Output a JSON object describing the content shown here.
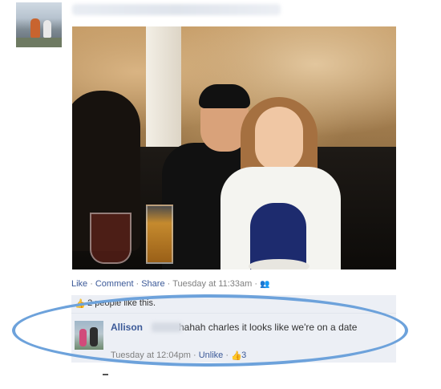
{
  "post": {
    "photo_actions": {
      "like": "Like",
      "comment": "Comment",
      "share": "Share",
      "timestamp": "Tuesday at 11:33am",
      "sep": "·"
    },
    "likes_summary": "2 people like this.",
    "comment": {
      "author": "Allison",
      "text": "hahah charles it looks like we're on a date",
      "timestamp": "Tuesday at 12:04pm",
      "unlike": "Unlike",
      "like_count": "3"
    }
  },
  "icons": {
    "thumbs_up": "thumbs-up-icon",
    "privacy": "friends-icon"
  },
  "colors": {
    "link": "#3b5998",
    "meta": "#7f7f7f",
    "ufi_bg": "#eceff5",
    "annotation": "#6da2db"
  }
}
